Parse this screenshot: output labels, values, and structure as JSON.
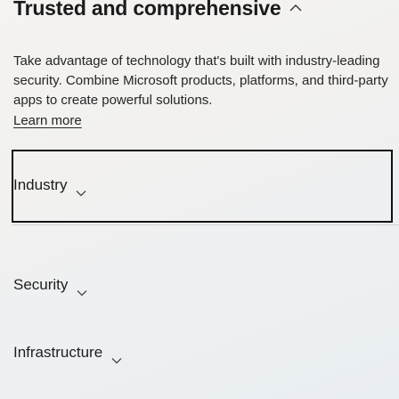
{
  "section": {
    "title": "Trusted and comprehensive",
    "title_icon": "chevron-up-icon"
  },
  "intro": {
    "text": "Take advantage of technology that's built with industry-leading security. Combine Microsoft products, platforms, and third-party apps to create powerful solutions.",
    "learn_more_label": "Learn more"
  },
  "categories": [
    {
      "label": "Industry",
      "icon": "chevron-down-icon",
      "focused": true
    },
    {
      "label": "Security",
      "icon": "chevron-down-icon",
      "focused": false
    },
    {
      "label": "Infrastructure",
      "icon": "chevron-down-icon",
      "focused": false
    }
  ],
  "colors": {
    "text": "#1b1b1b",
    "focus_outline": "#111111",
    "divider": "#cfd2d4"
  }
}
